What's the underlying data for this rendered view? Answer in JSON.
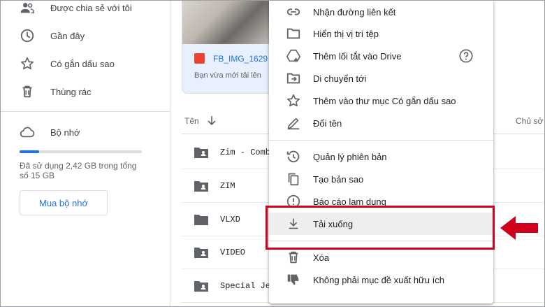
{
  "sidebar": {
    "items": [
      {
        "label": "Được chia sẻ với tôi",
        "icon": "people-icon"
      },
      {
        "label": "Gần đây",
        "icon": "clock-icon"
      },
      {
        "label": "Có gắn dấu sao",
        "icon": "star-icon"
      },
      {
        "label": "Thùng rác",
        "icon": "trash-icon"
      }
    ],
    "storage": {
      "label": "Bộ nhớ",
      "icon": "cloud-icon",
      "used_text": "Đã sử dụng 2,42 GB trong tổng số 15 GB",
      "used_fraction": 0.16
    },
    "buy_button": "Mua bộ nhớ"
  },
  "suggested_card": {
    "file_name": "FB_IMG_1629",
    "subtitle": "Bạn vừa mới tải lên",
    "file_icon": "image-file-icon"
  },
  "file_list": {
    "columns": {
      "name": "Tên",
      "sort_icon": "arrow-down-icon",
      "owner": "Chủ sở"
    },
    "rows": [
      {
        "name": "Zim - Combo",
        "icon": "shared-folder-icon"
      },
      {
        "name": "ZIM",
        "icon": "shared-folder-icon"
      },
      {
        "name": "VLXD",
        "icon": "folder-icon"
      },
      {
        "name": "VIDEO",
        "icon": "shared-folder-icon"
      },
      {
        "name": "Special Je",
        "icon": "shared-folder-icon"
      }
    ]
  },
  "context_menu": {
    "items": [
      {
        "label": "Nhận đường liên kết",
        "icon": "link-icon"
      },
      {
        "label": "Hiển thị vị trí tệp",
        "icon": "folder-outline-icon"
      },
      {
        "label": "Thêm lối tắt vào Drive",
        "icon": "add-shortcut-icon",
        "help_icon": "help-icon"
      },
      {
        "label": "Di chuyển tới",
        "icon": "move-to-folder-icon"
      },
      {
        "label": "Thêm vào thư mục Có gắn dấu sao",
        "icon": "star-outline-icon"
      },
      {
        "label": "Đổi tên",
        "icon": "pencil-icon"
      },
      {
        "label": "Quản lý phiên bản",
        "icon": "history-icon"
      },
      {
        "label": "Tạo bản sao",
        "icon": "copy-icon"
      },
      {
        "label": "Báo cáo lạm dụng",
        "icon": "report-icon"
      },
      {
        "label": "Tải xuống",
        "icon": "download-icon",
        "highlighted": true
      },
      {
        "label": "Xóa",
        "icon": "trash-icon"
      },
      {
        "label": "Không phải mục đề xuất hữu ích",
        "icon": "thumbs-down-icon"
      }
    ]
  },
  "annotation": {
    "color": "#d0021b",
    "arrow_icon": "red-arrow-icon"
  }
}
